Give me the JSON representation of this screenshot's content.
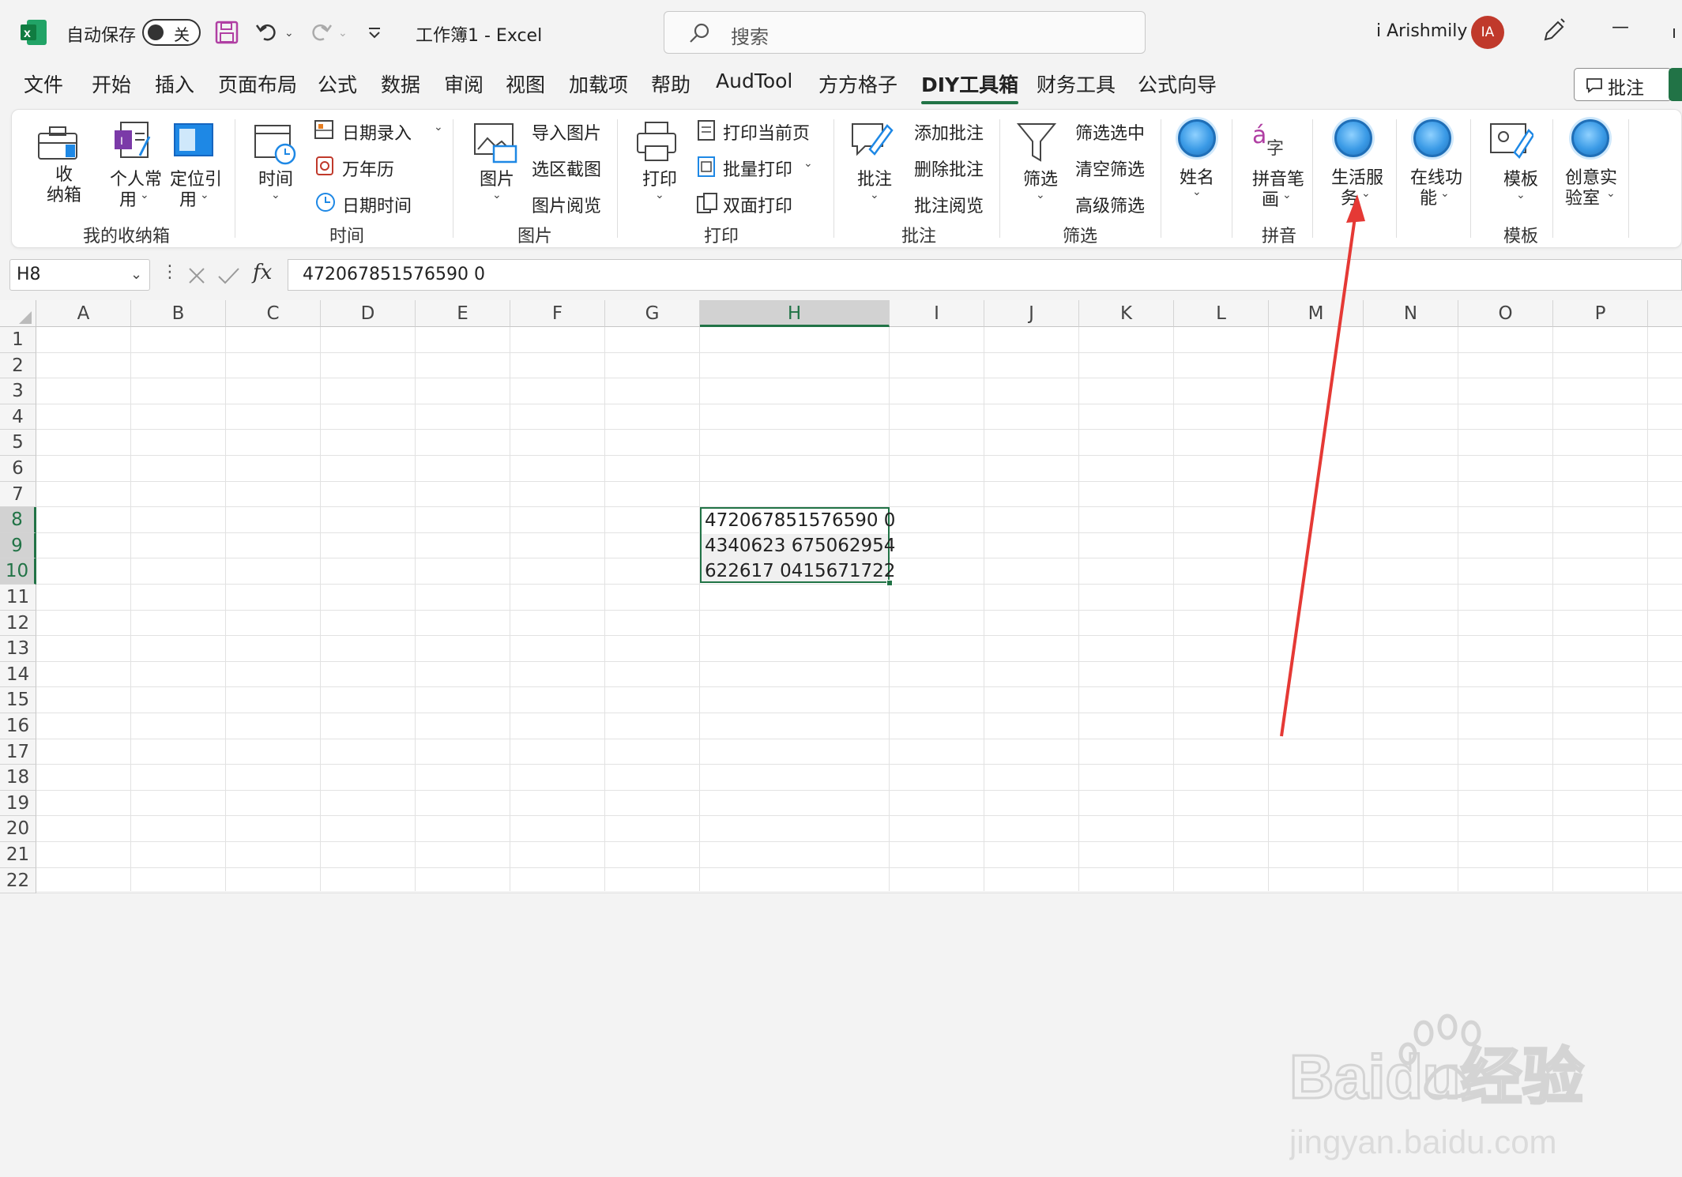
{
  "titlebar": {
    "autosave_label": "自动保存",
    "toggle_state": "关",
    "file_title": "工作簿1  -  Excel",
    "search_placeholder": "搜索",
    "user_name": "i Arishmily",
    "avatar_initials": "IA",
    "minimize": "—"
  },
  "tabs": [
    "文件",
    "开始",
    "插入",
    "页面布局",
    "公式",
    "数据",
    "审阅",
    "视图",
    "加载项",
    "帮助",
    "AudTool",
    "方方格子",
    "DIY工具箱",
    "财务工具",
    "公式向导"
  ],
  "comment_button": "批注",
  "ribbon": {
    "groups": {
      "storage": "我的收纳箱",
      "time": "时间",
      "picture": "图片",
      "print": "打印",
      "comment": "批注",
      "filter": "筛选",
      "pinyin": "拼音",
      "template": "模板"
    },
    "storage_box": "收\n纳箱",
    "personal_l1": "个人常",
    "personal_l2": "用",
    "locate_l1": "定位引",
    "locate_l2": "用",
    "time_btn": "时间",
    "date_entry": "日期录入",
    "calendar": "万年历",
    "datetime": "日期时间",
    "picture_btn": "图片",
    "import_pic": "导入图片",
    "region_shot": "选区截图",
    "pic_view": "图片阅览",
    "print_btn": "打印",
    "print_current": "打印当前页",
    "batch_print": "批量打印",
    "duplex_print": "双面打印",
    "comment_btn": "批注",
    "add_comment": "添加批注",
    "del_comment": "删除批注",
    "view_comment": "批注阅览",
    "filter_btn": "筛选",
    "filter_sel": "筛选选中",
    "clear_filter": "清空筛选",
    "adv_filter": "高级筛选",
    "name_btn": "姓名",
    "pinyin_l1": "拼音笔",
    "pinyin_l2": "画",
    "life_l1": "生活服",
    "life_l2": "务",
    "online_l1": "在线功",
    "online_l2": "能",
    "template_btn": "模板",
    "lab_l1": "创意实",
    "lab_l2": "验室"
  },
  "formula_bar": {
    "name_box": "H8",
    "fx": "fx",
    "content": "472067851576590 0"
  },
  "columns": [
    "A",
    "B",
    "C",
    "D",
    "E",
    "F",
    "G",
    "H",
    "I",
    "J",
    "K",
    "L",
    "M",
    "N",
    "O",
    "P"
  ],
  "rows": [
    "1",
    "2",
    "3",
    "4",
    "5",
    "6",
    "7",
    "8",
    "9",
    "10",
    "11",
    "12",
    "13",
    "14",
    "15",
    "16",
    "17",
    "18",
    "19",
    "20",
    "21",
    "22"
  ],
  "cells": {
    "H8": "472067851576590 0",
    "H9": "4340623 675062954",
    "H10": "622617 0415671722"
  },
  "watermark": {
    "brand": "Baidu经验",
    "url": "jingyan.baidu.com"
  },
  "colors": {
    "excel_green": "#217346",
    "annotation_red": "#e53935",
    "avatar_bg": "#c0392b"
  }
}
